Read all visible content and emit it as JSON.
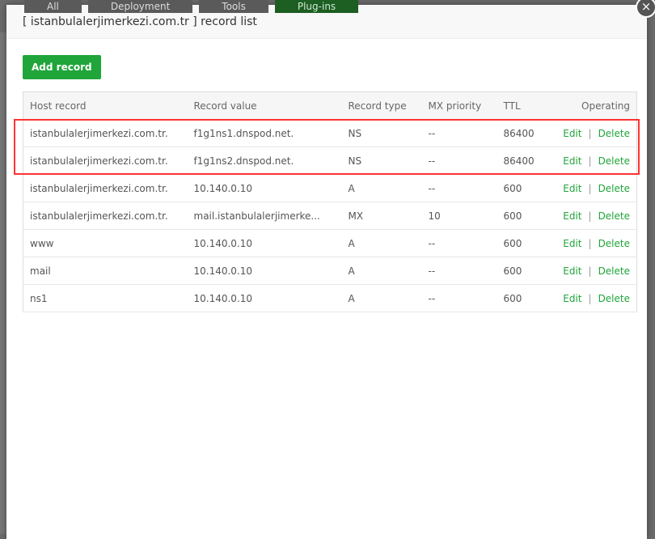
{
  "background_tabs": [
    "All",
    "Deployment",
    "Tools",
    "Plug-ins"
  ],
  "modal": {
    "title": "[ istanbulalerjimerkezi.com.tr ] record list",
    "close_icon": "×",
    "add_label": "Add record"
  },
  "table": {
    "headers": [
      "Host record",
      "Record value",
      "Record type",
      "MX priority",
      "TTL",
      "Operating"
    ],
    "rows": [
      [
        "istanbulalerjimerkezi.com.tr.",
        "f1g1ns1.dnspod.net.",
        "NS",
        "--",
        "86400"
      ],
      [
        "istanbulalerjimerkezi.com.tr.",
        "f1g1ns2.dnspod.net.",
        "NS",
        "--",
        "86400"
      ],
      [
        "istanbulalerjimerkezi.com.tr.",
        "10.140.0.10",
        "A",
        "--",
        "600"
      ],
      [
        "istanbulalerjimerkezi.com.tr.",
        "mail.istanbulalerjimerke...",
        "MX",
        "10",
        "600"
      ],
      [
        "www",
        "10.140.0.10",
        "A",
        "--",
        "600"
      ],
      [
        "mail",
        "10.140.0.10",
        "A",
        "--",
        "600"
      ],
      [
        "ns1",
        "10.140.0.10",
        "A",
        "--",
        "600"
      ]
    ],
    "edit_label": "Edit",
    "sep": "|",
    "delete_label": "Delete"
  },
  "colors": {
    "accent": "#20a53a",
    "highlight": "#ff3333"
  }
}
